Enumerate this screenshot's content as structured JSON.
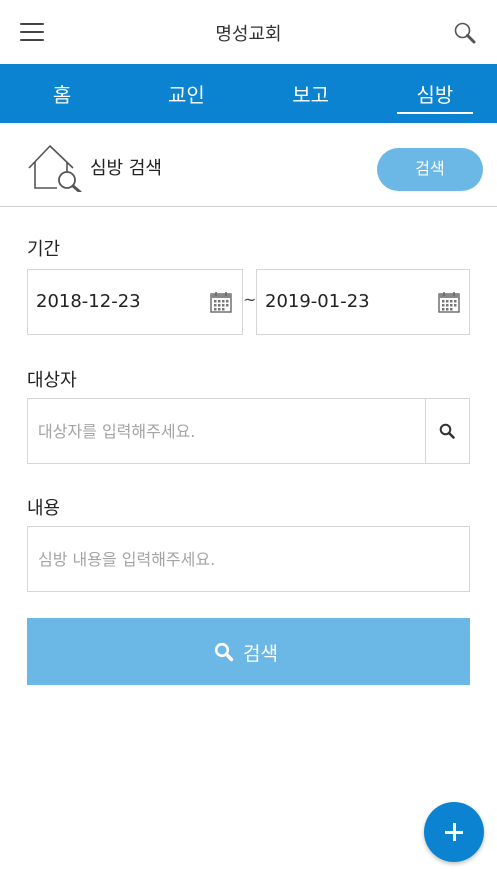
{
  "header": {
    "title": "명성교회",
    "menu_icon": "hamburger-menu-icon",
    "search_icon": "search-icon"
  },
  "tabs": [
    {
      "label": "홈",
      "active": false
    },
    {
      "label": "교인",
      "active": false
    },
    {
      "label": "보고",
      "active": false
    },
    {
      "label": "심방",
      "active": true
    }
  ],
  "section": {
    "title": "심방 검색",
    "icon": "house-search-icon",
    "search_button_label": "검색"
  },
  "form": {
    "period_label": "기간",
    "start_date": "2018-12-23",
    "end_date": "2019-01-23",
    "separator": "~",
    "target_label": "대상자",
    "target_placeholder": "대상자를 입력해주세요.",
    "target_value": "",
    "content_label": "내용",
    "content_placeholder": "심방 내용을 입력해주세요.",
    "content_value": "",
    "search_button_label": "검색"
  },
  "fab": {
    "icon": "plus-icon"
  },
  "colors": {
    "primary": "#0b83d0",
    "button": "#6bb8e6",
    "border": "#d6d6d6"
  }
}
